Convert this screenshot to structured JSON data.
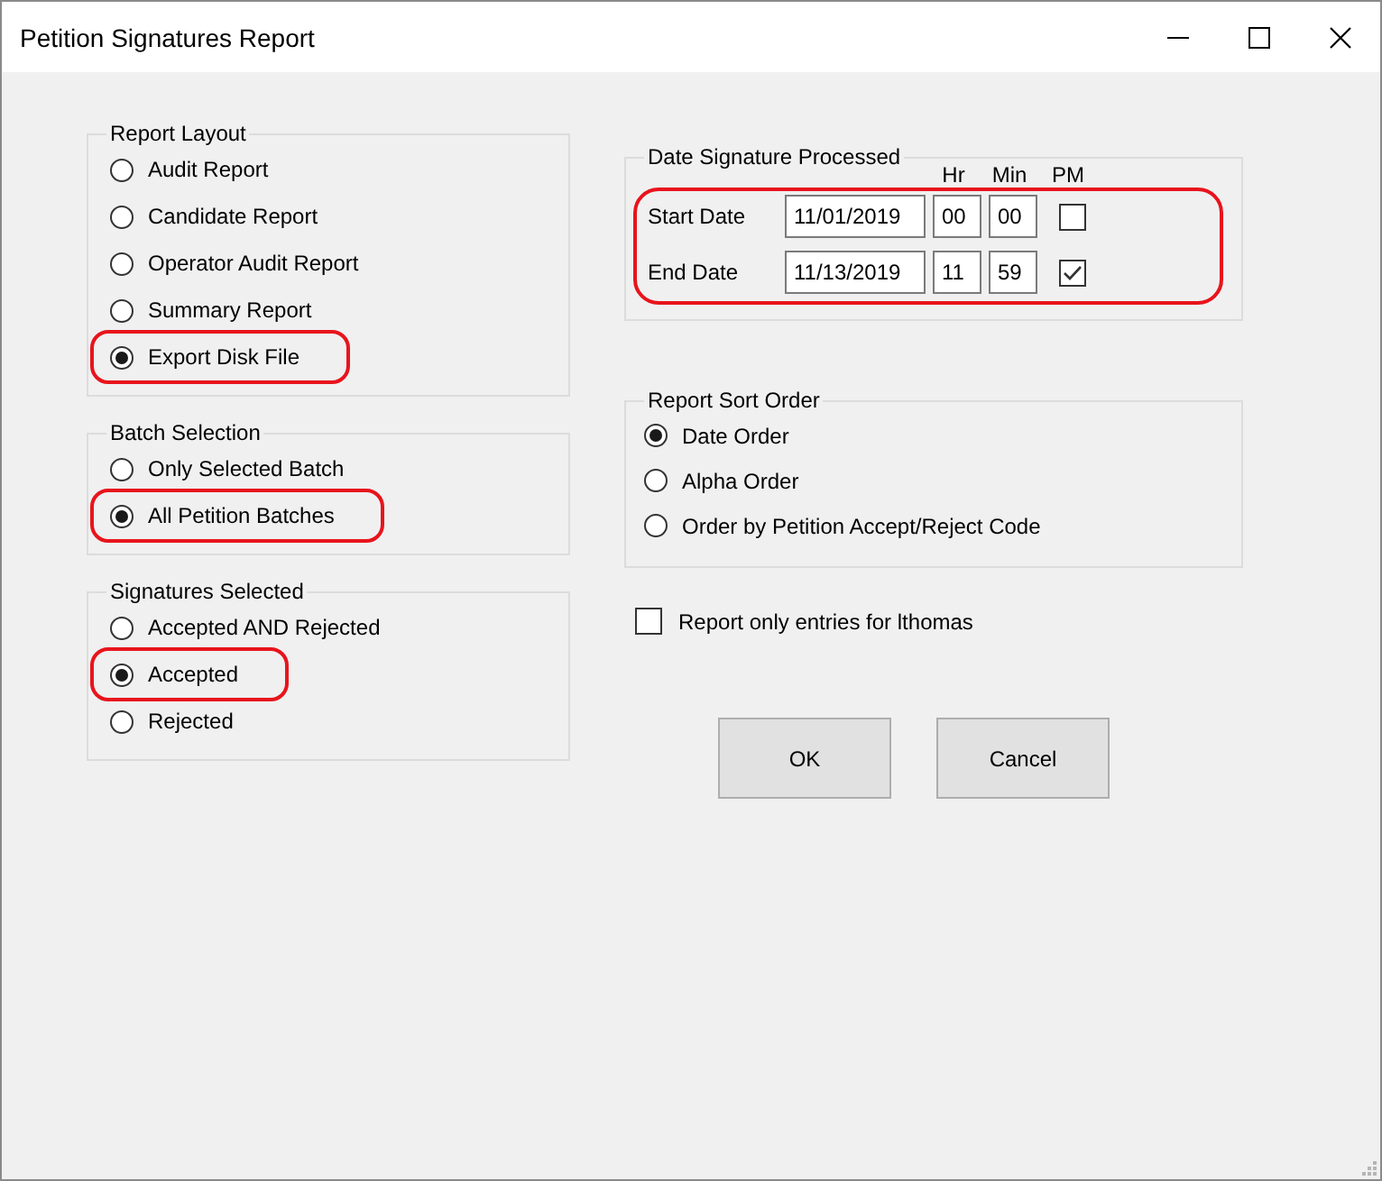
{
  "window": {
    "title": "Petition Signatures Report"
  },
  "left_groups": [
    {
      "title": "Report Layout",
      "options": [
        {
          "label": "Audit Report",
          "selected": false,
          "circled": false
        },
        {
          "label": "Candidate Report",
          "selected": false,
          "circled": false
        },
        {
          "label": "Operator Audit Report",
          "selected": false,
          "circled": false
        },
        {
          "label": "Summary Report",
          "selected": false,
          "circled": false
        },
        {
          "label": "Export Disk File",
          "selected": true,
          "circled": true
        }
      ]
    },
    {
      "title": "Batch Selection",
      "options": [
        {
          "label": "Only Selected Batch",
          "selected": false,
          "circled": false
        },
        {
          "label": "All Petition Batches",
          "selected": true,
          "circled": true
        }
      ]
    },
    {
      "title": "Signatures Selected",
      "options": [
        {
          "label": "Accepted AND Rejected",
          "selected": false,
          "circled": false
        },
        {
          "label": "Accepted",
          "selected": true,
          "circled": true
        },
        {
          "label": "Rejected",
          "selected": false,
          "circled": false
        }
      ]
    }
  ],
  "date_group": {
    "title": "Date Signature Processed",
    "headers": [
      "Hr",
      "Min",
      "PM"
    ],
    "circled": true,
    "rows": [
      {
        "label": "Start Date",
        "date": "11/01/2019",
        "hour": "00",
        "minute": "00",
        "pm": false
      },
      {
        "label": "End Date",
        "date": "11/13/2019",
        "hour": "11",
        "minute": "59",
        "pm": true
      }
    ]
  },
  "sort_group": {
    "title": "Report Sort Order",
    "options": [
      {
        "label": "Date Order",
        "selected": true
      },
      {
        "label": "Alpha Order",
        "selected": false
      },
      {
        "label": "Order by Petition Accept/Reject Code",
        "selected": false
      }
    ]
  },
  "only_user": {
    "label": "Report only entries for lthomas",
    "checked": false
  },
  "buttons": [
    "OK",
    "Cancel"
  ]
}
